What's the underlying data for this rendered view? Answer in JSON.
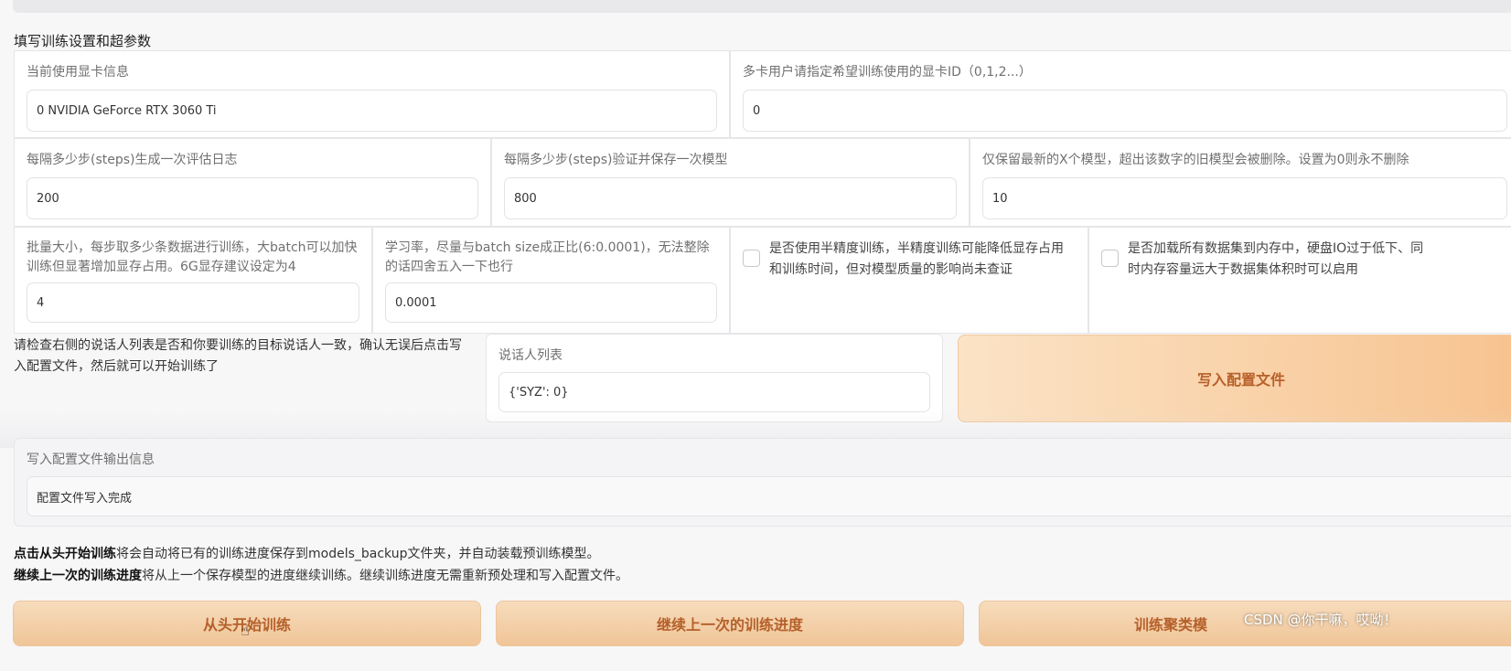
{
  "section_title": "填写训练设置和超参数",
  "gpu": {
    "label": "当前使用显卡信息",
    "value": "0  NVIDIA GeForce RTX 3060 Ti",
    "multi_label": "多卡用户请指定希望训练使用的显卡ID（0,1,2...）",
    "multi_value": "0"
  },
  "steps": {
    "eval_label": "每隔多少步(steps)生成一次评估日志",
    "eval_value": "200",
    "save_label": "每隔多少步(steps)验证并保存一次模型",
    "save_value": "800",
    "keep_label": "仅保留最新的X个模型，超出该数字的旧模型会被删除。设置为0则永不删除",
    "keep_value": "10"
  },
  "batch": {
    "label": "批量大小，每步取多少条数据进行训练，大batch可以加快训练但显著增加显存占用。6G显存建议设定为4",
    "value": "4"
  },
  "lr": {
    "label": "学习率，尽量与batch size成正比(6:0.0001)，无法整除的话四舍五入一下也行",
    "value": "0.0001"
  },
  "fp16": {
    "label": "是否使用半精度训练，半精度训练可能降低显存占用和训练时间，但对模型质量的影响尚未查证",
    "checked": false
  },
  "load_all": {
    "label": "是否加载所有数据集到内存中，硬盘IO过于低下、同时内存容量远大于数据集体积时可以启用",
    "checked": false
  },
  "check_note": "请检查右侧的说话人列表是否和你要训练的目标说话人一致，确认无误后点击写入配置文件，然后就可以开始训练了",
  "speakers": {
    "label": "说话人列表",
    "value": "{'SYZ': 0}"
  },
  "write_config_button": "写入配置文件",
  "output": {
    "label": "写入配置文件输出信息",
    "value": "配置文件写入完成"
  },
  "info": {
    "line1_bold": "点击从头开始训练",
    "line1_rest": "将会自动将已有的训练进度保存到models_backup文件夹，并自动装载预训练模型。",
    "line2_bold": "继续上一次的训练进度",
    "line2_rest": "将从上一个保存模型的进度继续训练。继续训练进度无需重新预处理和写入配置文件。"
  },
  "buttons": {
    "start": "从头开始训练",
    "resume": "继续上一次的训练进度",
    "cluster": "训练聚类模"
  },
  "watermark": "CSDN @你干嘛，哎呦！",
  "colors": {
    "accent_text": "#b8602a",
    "button_gradient_start": "#fbe3c6",
    "button_gradient_end": "#f7c38f"
  }
}
